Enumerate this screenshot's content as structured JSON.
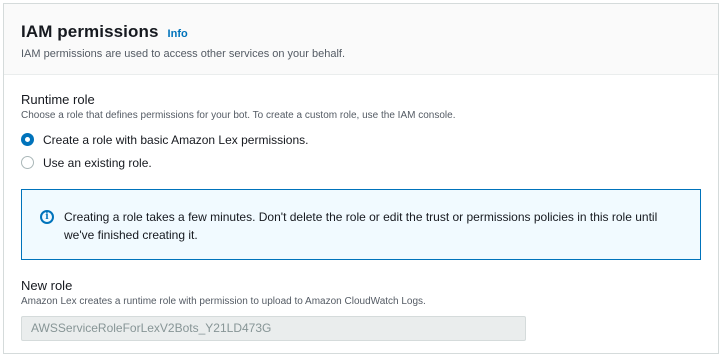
{
  "panel": {
    "title": "IAM permissions",
    "info_link": "Info",
    "description": "IAM permissions are used to access other services on your behalf."
  },
  "runtime_role": {
    "label": "Runtime role",
    "description": "Choose a role that defines permissions for your bot. To create a custom role, use the IAM console.",
    "options": [
      {
        "label": "Create a role with basic Amazon Lex permissions.",
        "selected": true
      },
      {
        "label": "Use an existing role.",
        "selected": false
      }
    ]
  },
  "alert": {
    "icon": "info-circle-icon",
    "text": "Creating a role takes a few minutes. Don't delete the role or edit the trust or permissions policies in this role until we've finished creating it."
  },
  "new_role": {
    "label": "New role",
    "description": "Amazon Lex creates a runtime role with permission to upload to Amazon CloudWatch Logs.",
    "value": "AWSServiceRoleForLexV2Bots_Y21LD473G"
  },
  "colors": {
    "accent": "#0073bb",
    "alert_background": "#f1faff",
    "disabled_input": "#eaeded"
  }
}
